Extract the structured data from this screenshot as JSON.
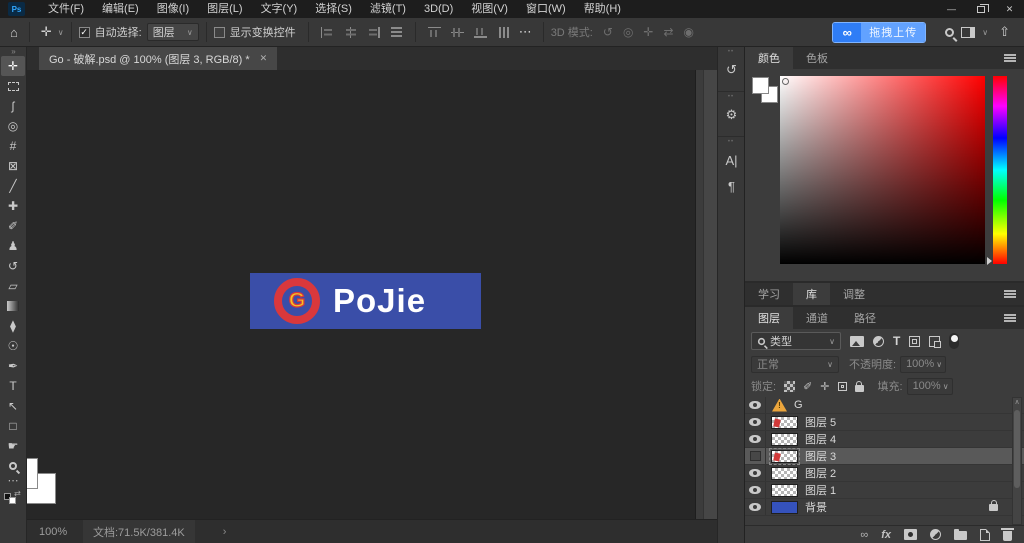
{
  "titlebar": {
    "app_icon": "Ps",
    "menus": [
      {
        "id": "file",
        "label": "文件(F)"
      },
      {
        "id": "edit",
        "label": "编辑(E)"
      },
      {
        "id": "image",
        "label": "图像(I)"
      },
      {
        "id": "layer",
        "label": "图层(L)"
      },
      {
        "id": "type",
        "label": "文字(Y)"
      },
      {
        "id": "select",
        "label": "选择(S)"
      },
      {
        "id": "filter",
        "label": "滤镜(T)"
      },
      {
        "id": "3d",
        "label": "3D(D)"
      },
      {
        "id": "view",
        "label": "视图(V)"
      },
      {
        "id": "window",
        "label": "窗口(W)"
      },
      {
        "id": "help",
        "label": "帮助(H)"
      }
    ],
    "window_controls": {
      "minimize": "—",
      "close": "✕"
    }
  },
  "options": {
    "home_icon": "⌂",
    "active_tool_glyph": "✛",
    "auto_select_label": "自动选择:",
    "auto_select_checked": "✓",
    "layer_select_value": "图层",
    "show_transform_label": "显示变换控件",
    "ellipsis": "⋯",
    "mode3d_label": "3D 模式:",
    "mode3d_icons": [
      {
        "id": "orbit",
        "glyph": "↺"
      },
      {
        "id": "roll",
        "glyph": "◎"
      },
      {
        "id": "pan",
        "glyph": "✛"
      },
      {
        "id": "slide",
        "glyph": "⇄"
      },
      {
        "id": "camera",
        "glyph": "◉"
      }
    ],
    "upload_cloud_glyph": "∞",
    "upload_label": "拖拽上传",
    "share_glyph": "⇧",
    "dropdown_chevron": "∨"
  },
  "toolbar": {
    "collapse_glyph": "»",
    "ellipsis": "⋯",
    "tools": [
      {
        "id": "move",
        "glyph": "✛",
        "selected": true
      },
      {
        "id": "marquee",
        "glyph": ""
      },
      {
        "id": "lasso",
        "glyph": "ʃ"
      },
      {
        "id": "object-selection",
        "glyph": "◎"
      },
      {
        "id": "crop",
        "glyph": "#"
      },
      {
        "id": "frame",
        "glyph": "⊠"
      },
      {
        "id": "eyedropper",
        "glyph": "╱"
      },
      {
        "id": "healing-brush",
        "glyph": "✚"
      },
      {
        "id": "brush",
        "glyph": "✐"
      },
      {
        "id": "clone-stamp",
        "glyph": "♟"
      },
      {
        "id": "history-brush",
        "glyph": "↺"
      },
      {
        "id": "eraser",
        "glyph": "▱"
      },
      {
        "id": "gradient",
        "glyph": ""
      },
      {
        "id": "blur",
        "glyph": "⧫"
      },
      {
        "id": "dodge",
        "glyph": "☉"
      },
      {
        "id": "pen",
        "glyph": "✒"
      },
      {
        "id": "type",
        "glyph": "T"
      },
      {
        "id": "path-selection",
        "glyph": "↖"
      },
      {
        "id": "rectangle",
        "glyph": "□"
      },
      {
        "id": "hand",
        "glyph": "☛"
      },
      {
        "id": "zoom",
        "glyph": ""
      }
    ]
  },
  "doc": {
    "tab_title": "Go - 破解.psd @ 100% (图层 3, RGB/8) *",
    "tab_close": "✕",
    "banner": {
      "text": "PoJie",
      "logo_letter": "G"
    },
    "status": {
      "zoom": "100%",
      "info": "文档:71.5K/381.4K",
      "chevron": "›"
    }
  },
  "side_strip": [
    {
      "id": "history",
      "glyph": "↺"
    },
    {
      "id": "properties",
      "glyph": "⚙"
    },
    {
      "id": "character",
      "glyph": "A|"
    },
    {
      "id": "paragraph",
      "glyph": "¶"
    }
  ],
  "panels": {
    "color": {
      "tab_color": "颜色",
      "tab_swatches": "色板"
    },
    "mid": {
      "tab_learn": "学习",
      "tab_library": "库",
      "tab_adjust": "调整"
    },
    "layers_tabs": {
      "tab_layers": "图层",
      "tab_channels": "通道",
      "tab_paths": "路径"
    },
    "filter": {
      "kind_label": "类型"
    },
    "blend": {
      "mode": "正常",
      "opacity_label": "不透明度:",
      "opacity_value": "100%"
    },
    "lock": {
      "label": "锁定:",
      "fill_label": "填充:",
      "fill_value": "100%"
    },
    "layers": [
      {
        "name": "G"
      },
      {
        "name": "图层 5"
      },
      {
        "name": "图层 4"
      },
      {
        "name": "图层 3"
      },
      {
        "name": "图层 2"
      },
      {
        "name": "图层 1"
      },
      {
        "name": "背景"
      }
    ]
  },
  "colors": {
    "banner_blue": "#3a4ea8",
    "logo_red": "#d9383c",
    "logo_yellow": "#f5c324",
    "baidu_blue": "#2f7df6",
    "selected_row": "#595959"
  }
}
